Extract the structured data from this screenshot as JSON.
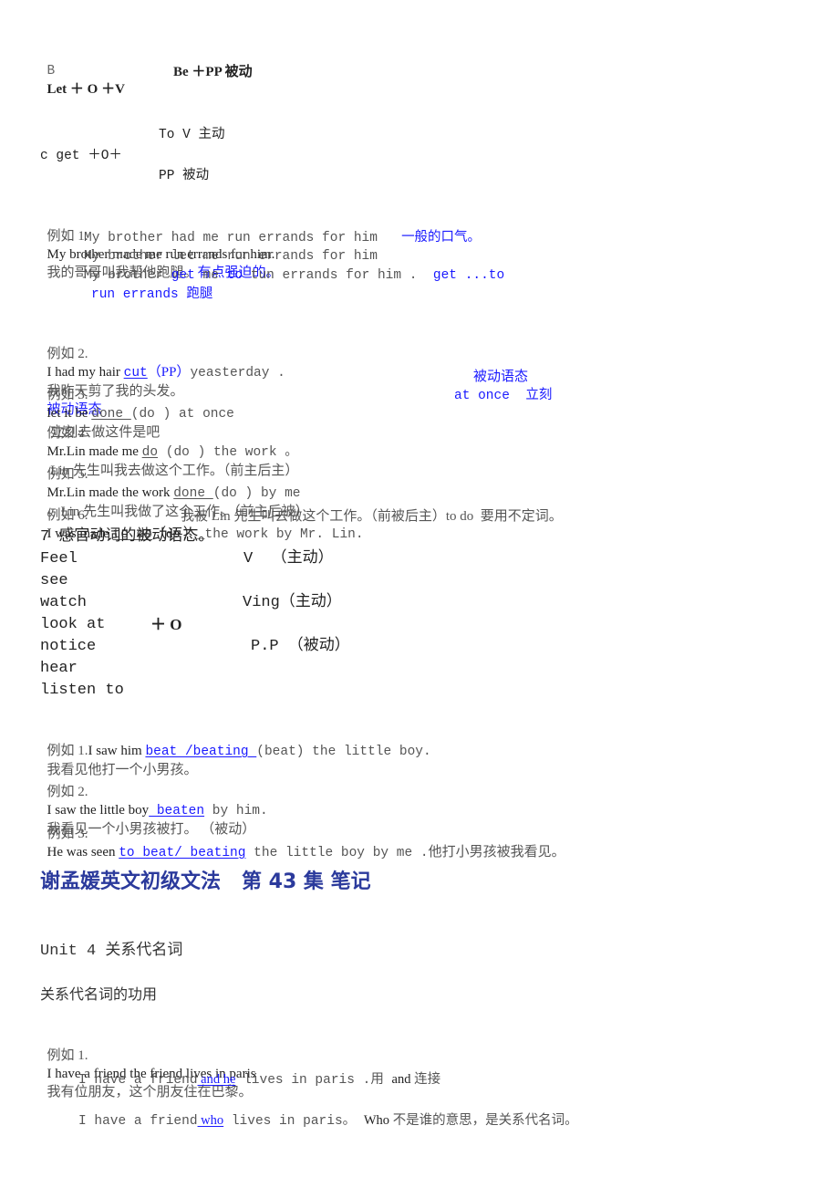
{
  "patterns": {
    "let": {
      "prefix": "B",
      "formula": "Let ＋ O ＋V",
      "passive": "Be ＋PP 被动"
    },
    "get": {
      "active": "To V 主动",
      "formula": "c get ＋O＋",
      "passive": "PP 被动"
    }
  },
  "examples_a": {
    "ex1": {
      "label": "例如 1.",
      "sentence": "My brother made me run errands for him.",
      "translation": "我的哥哥叫我帮他跑腿。",
      "note": "有点强迫的。",
      "line2": "My brother had me run errands for him",
      "line2_note": "一般的口气。",
      "line3": "My brother let me run errands for him",
      "line4_a": "My brother ",
      "line4_get": "get",
      "line4_b": " me ",
      "line4_to": "to",
      "line4_c": " tun errands for him .",
      "line4_note": "get ...to",
      "line5": "run errands 跑腿"
    },
    "ex2": {
      "label": "例如 2.",
      "sentence_a": "I had my hair ",
      "blank": "cut",
      "hint": "（PP）",
      "sentence_b": "yeasterday .",
      "translation": "我昨天剪了我的头发。",
      "note": "被动语态"
    },
    "ex3": {
      "label": "例如 3.",
      "sentence_a": "let it be ",
      "blank": "done ",
      "sentence_b": "(do ) at once",
      "translation": "立刻去做这件是吧",
      "note": "被动语态",
      "note2": "at once  立刻"
    },
    "ex4": {
      "label": "例如 4",
      "sentence_a": "Mr.Lin made me ",
      "blank": "do",
      "sentence_b": " (do ) the work 。",
      "translation": "Lin 先生叫我去做这个工作。（前主后主）"
    },
    "ex5": {
      "label": "例如 5.",
      "sentence_a": "Mr.Lin made the work ",
      "blank": "done ",
      "sentence_b": "(do ) by me",
      "translation": "。Lin 先生叫我做了这个工作。（前主后被）"
    },
    "ex6": {
      "label": "例如 6.",
      "sentence_a": "I was made ",
      "blank": "to do",
      "sentence_b": "（do ）",
      "sentence_c": "_the work by Mr. Lin.",
      "translation": "我被 Lin 先生叫去做这个工作。（前被后主）to do  要用不定词。"
    }
  },
  "senses": {
    "heading": "7 感官动词的被动语态。",
    "verbs": [
      "Feel",
      "see",
      "watch",
      "look at",
      "notice",
      "hear",
      "listen to"
    ],
    "plus_o": "＋ O",
    "forms": [
      "V  （主动）",
      "Ving（主动）",
      "P.P （被动）"
    ]
  },
  "examples_b": {
    "ex1": {
      "label": "例如 1.",
      "sentence_a": "I saw him ",
      "blank": "beat /beating ",
      "sentence_b": "(beat) the little boy.",
      "translation": "我看见他打一个小男孩。"
    },
    "ex2": {
      "label": "例如 2.",
      "sentence_a": "I saw the little boy",
      "blank": " beaten",
      "sentence_b": " by him.",
      "translation": "我看见一个小男孩被打。 （被动）"
    },
    "ex3": {
      "label": "例如 3.",
      "sentence_a": "He was seen ",
      "blank": "to beat/ beating",
      "sentence_b": " the little boy by me .",
      "translation": "他打小男孩被我看见。"
    }
  },
  "section": {
    "title": "谢孟媛英文初级文法   第 43 集 笔记",
    "unit": "Unit 4 关系代名词",
    "subheading": "关系代名词的功用"
  },
  "examples_c": {
    "ex1": {
      "label": "例如 1.",
      "sentence": "I have a friend the friend lives in paris",
      "translation": "我有位朋友，这个朋友住在巴黎。"
    },
    "line2": {
      "a": "I have a friend",
      "blank": " and he",
      "b": " lives in paris .用 ",
      "c": "and",
      "d": " 连接"
    },
    "line3": {
      "a": "I have a friend",
      "blank": " who",
      "b": " lives in paris。 ",
      "c": "Who",
      "d": " 不是谁的意思，是关系代名词。"
    }
  }
}
